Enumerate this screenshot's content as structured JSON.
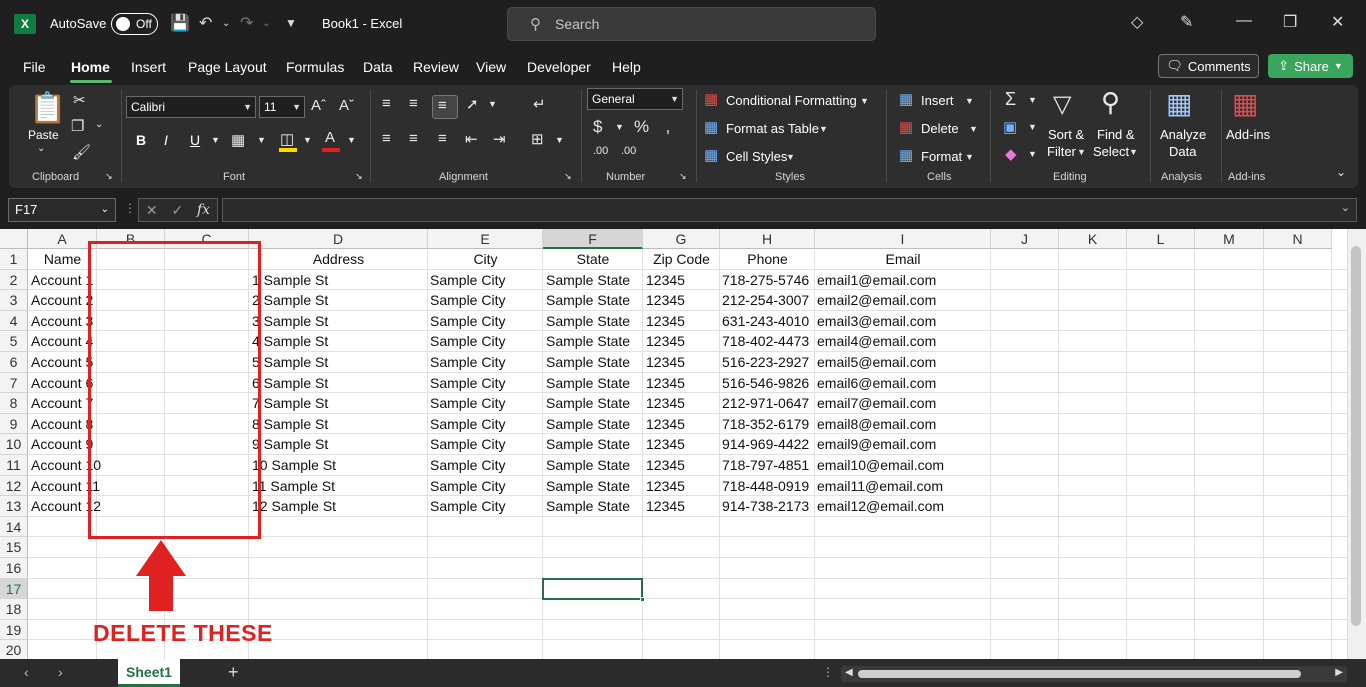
{
  "titlebar": {
    "autosave_label": "AutoSave",
    "autosave_state": "Off",
    "doc_title": "Book1  -  Excel",
    "search_placeholder": "Search"
  },
  "menu": [
    "File",
    "Home",
    "Insert",
    "Page Layout",
    "Formulas",
    "Data",
    "Review",
    "View",
    "Developer",
    "Help"
  ],
  "active_menu": "Home",
  "actions": {
    "comments": "Comments",
    "share": "Share"
  },
  "ribbon": {
    "clipboard": {
      "paste": "Paste",
      "label": "Clipboard"
    },
    "font": {
      "name": "Calibri",
      "size": "11",
      "label": "Font",
      "bold": "B",
      "italic": "I",
      "underline": "U"
    },
    "alignment": {
      "label": "Alignment"
    },
    "number": {
      "format": "General",
      "label": "Number"
    },
    "styles": {
      "conditional": "Conditional Formatting",
      "table": "Format as Table",
      "cell": "Cell Styles",
      "label": "Styles"
    },
    "cells": {
      "insert": "Insert",
      "delete": "Delete",
      "format": "Format",
      "label": "Cells"
    },
    "editing": {
      "sort1": "Sort &",
      "sort2": "Filter",
      "find1": "Find &",
      "find2": "Select",
      "label": "Editing"
    },
    "analysis": {
      "btn1": "Analyze",
      "btn2": "Data",
      "label": "Analysis"
    },
    "addins": {
      "btn": "Add-ins",
      "label": "Add-ins"
    }
  },
  "formula_bar": {
    "name_box": "F17",
    "fx": "fx"
  },
  "columns": [
    "A",
    "B",
    "C",
    "D",
    "E",
    "F",
    "G",
    "H",
    "I",
    "J",
    "K",
    "L",
    "M",
    "N"
  ],
  "selected_column": "F",
  "row_numbers": [
    "1",
    "2",
    "3",
    "4",
    "5",
    "6",
    "7",
    "8",
    "9",
    "10",
    "11",
    "12",
    "13",
    "14",
    "15",
    "16",
    "17",
    "18",
    "19",
    "20"
  ],
  "selected_row": "17",
  "headers": {
    "name": "Name",
    "address": "Address",
    "city": "City",
    "state": "State",
    "zip": "Zip Code",
    "phone": "Phone",
    "email": "Email"
  },
  "rows": [
    {
      "name": "Account 1",
      "address": "1 Sample St",
      "city": "Sample City",
      "state": "Sample State",
      "zip": "12345",
      "phone": "718-275-5746",
      "email": "email1@email.com"
    },
    {
      "name": "Account 2",
      "address": "2 Sample St",
      "city": "Sample City",
      "state": "Sample State",
      "zip": "12345",
      "phone": "212-254-3007",
      "email": "email2@email.com"
    },
    {
      "name": "Account 3",
      "address": "3 Sample St",
      "city": "Sample City",
      "state": "Sample State",
      "zip": "12345",
      "phone": "631-243-4010",
      "email": "email3@email.com"
    },
    {
      "name": "Account 4",
      "address": "4 Sample St",
      "city": "Sample City",
      "state": "Sample State",
      "zip": "12345",
      "phone": "718-402-4473",
      "email": "email4@email.com"
    },
    {
      "name": "Account 5",
      "address": "5 Sample St",
      "city": "Sample City",
      "state": "Sample State",
      "zip": "12345",
      "phone": "516-223-2927",
      "email": "email5@email.com"
    },
    {
      "name": "Account 6",
      "address": "6 Sample St",
      "city": "Sample City",
      "state": "Sample State",
      "zip": "12345",
      "phone": "516-546-9826",
      "email": "email6@email.com"
    },
    {
      "name": "Account 7",
      "address": "7 Sample St",
      "city": "Sample City",
      "state": "Sample State",
      "zip": "12345",
      "phone": "212-971-0647",
      "email": "email7@email.com"
    },
    {
      "name": "Account 8",
      "address": "8 Sample St",
      "city": "Sample City",
      "state": "Sample State",
      "zip": "12345",
      "phone": "718-352-6179",
      "email": "email8@email.com"
    },
    {
      "name": "Account 9",
      "address": "9 Sample St",
      "city": "Sample City",
      "state": "Sample State",
      "zip": "12345",
      "phone": "914-969-4422",
      "email": "email9@email.com"
    },
    {
      "name": "Account 10",
      "address": "10 Sample St",
      "city": "Sample City",
      "state": "Sample State",
      "zip": "12345",
      "phone": "718-797-4851",
      "email": "email10@email.com"
    },
    {
      "name": "Account 11",
      "address": "11 Sample St",
      "city": "Sample City",
      "state": "Sample State",
      "zip": "12345",
      "phone": "718-448-0919",
      "email": "email11@email.com"
    },
    {
      "name": "Account 12",
      "address": "12 Sample St",
      "city": "Sample City",
      "state": "Sample State",
      "zip": "12345",
      "phone": "914-738-2173",
      "email": "email12@email.com"
    }
  ],
  "annotation": {
    "text": "DELETE THESE",
    "color": "#e02121"
  },
  "sheet_tab": "Sheet1",
  "accent_color": "#217346"
}
